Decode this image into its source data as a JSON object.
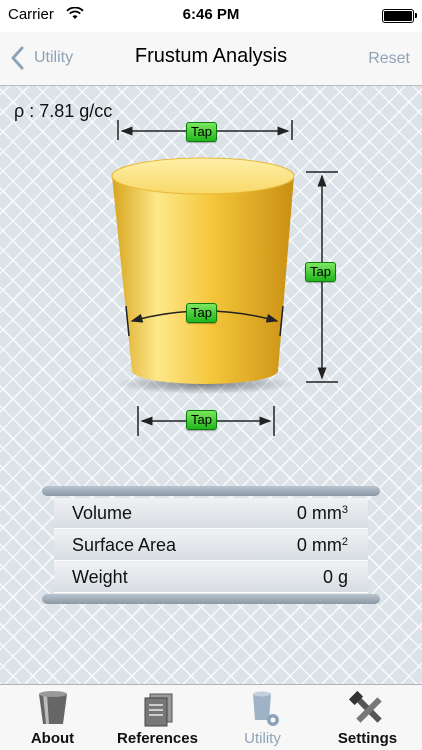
{
  "status_bar": {
    "carrier": "Carrier",
    "time": "6:46 PM"
  },
  "nav": {
    "back_label": "Utility",
    "title": "Frustum Analysis",
    "reset_label": "Reset"
  },
  "density": "ρ : 7.81 g/cc",
  "taps": {
    "top_diameter": "Tap",
    "height": "Tap",
    "mid_circumference": "Tap",
    "bottom_diameter": "Tap"
  },
  "results": [
    {
      "label": "Volume",
      "value": "0 mm",
      "unit_sup": "3"
    },
    {
      "label": "Surface Area",
      "value": "0 mm",
      "unit_sup": "2"
    },
    {
      "label": "Weight",
      "value": "0 g",
      "unit_sup": ""
    }
  ],
  "tabs": [
    {
      "label": "About",
      "icon": "cup-icon"
    },
    {
      "label": "References",
      "icon": "documents-icon"
    },
    {
      "label": "Utility",
      "icon": "utility-icon",
      "active": true
    },
    {
      "label": "Settings",
      "icon": "tools-icon"
    }
  ],
  "colors": {
    "accent": "#8fa3b8",
    "tap_green": "#22b51c",
    "frustum_gold": "#f5c73a"
  }
}
